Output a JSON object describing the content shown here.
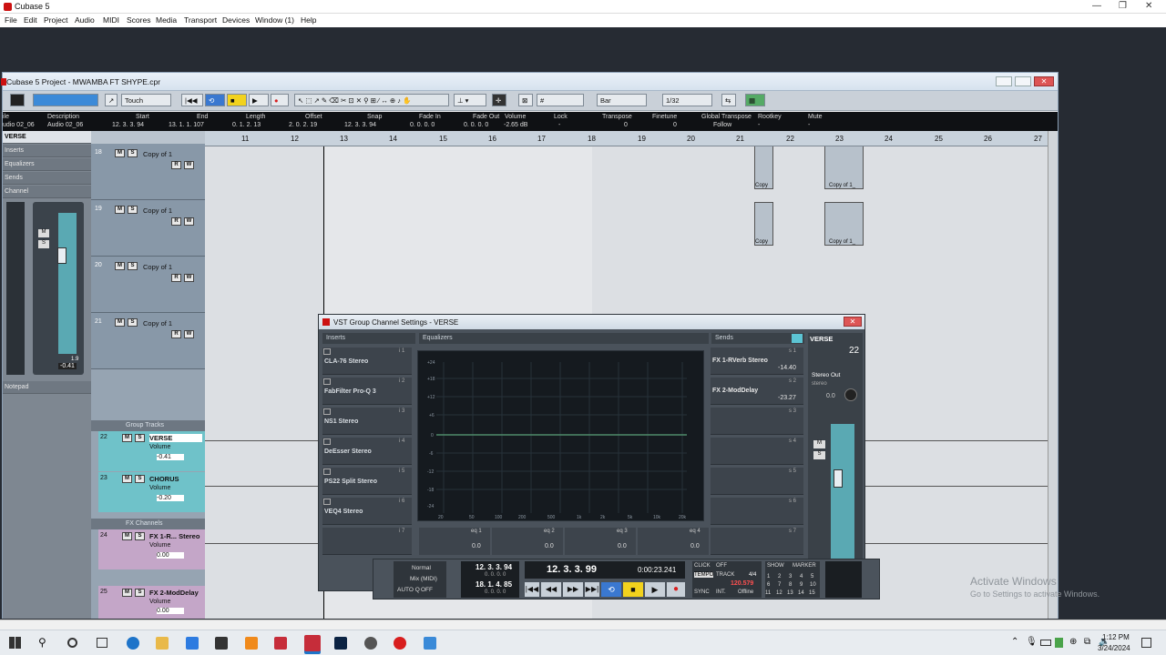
{
  "window": {
    "app_title": "Cubase 5",
    "min": "—",
    "max": "❐",
    "close": "✕"
  },
  "menu": [
    "File",
    "Edit",
    "Project",
    "Audio",
    "MIDI",
    "Scores",
    "Media",
    "Transport",
    "Devices",
    "Window (1)",
    "Help"
  ],
  "project": {
    "title": "Cubase 5 Project - MWAMBA FT SHYPE.cpr",
    "toolbar": {
      "automation_mode": "Touch",
      "grid_type": "Bar",
      "quantize": "1/32"
    },
    "infoline": {
      "headers": [
        "ile",
        "Description",
        "Start",
        "End",
        "Length",
        "Offset",
        "Snap",
        "Fade In",
        "Fade Out",
        "Volume",
        "Lock",
        "Transpose",
        "Finetune",
        "Global Transpose",
        "Rootkey",
        "Mute"
      ],
      "values": [
        "udio 02_06",
        "Audio 02_06",
        "12. 3. 3. 94",
        "13. 1. 1. 107",
        "0. 1. 2. 13",
        "2. 0. 2. 19",
        "12. 3. 3. 94",
        "0. 0. 0. 0",
        "0. 0. 0. 0",
        "-2.65 dB",
        "-",
        "0",
        "0",
        "Follow",
        "-",
        "-"
      ]
    },
    "inspector": {
      "track_name": "VERSE",
      "sections": [
        "Inserts",
        "Equalizers",
        "Sends",
        "Channel"
      ],
      "notepad": "Notepad",
      "fader_value": "-0.41",
      "meter_peak": "1.9"
    },
    "ruler": [
      "11",
      "12",
      "13",
      "14",
      "15",
      "16",
      "17",
      "18",
      "19",
      "20",
      "21",
      "22",
      "23",
      "24",
      "25",
      "26",
      "27"
    ],
    "tracks": [
      {
        "num": "18",
        "name": "Copy of 1"
      },
      {
        "num": "19",
        "name": "Copy of 1"
      },
      {
        "num": "20",
        "name": "Copy of 1"
      },
      {
        "num": "21",
        "name": "Copy of 1"
      }
    ],
    "folder_label": "Group Tracks",
    "group_tracks": [
      {
        "num": "22",
        "name": "VERSE",
        "param": "Volume",
        "value": "-0.41"
      },
      {
        "num": "23",
        "name": "CHORUS",
        "param": "Volume",
        "value": "-0.20"
      }
    ],
    "fx_folder_label": "FX Channels",
    "fx_tracks": [
      {
        "num": "24",
        "name": "FX 1-R... Stereo",
        "param": "Volume",
        "value": "0.00"
      },
      {
        "num": "25",
        "name": "FX 2-ModDelay",
        "param": "Volume",
        "value": "0.00"
      }
    ],
    "events": [
      "Copy",
      "Copy of 1_",
      "Copy",
      "Copy of 1_"
    ]
  },
  "vst": {
    "title": "VST Group Channel Settings - VERSE",
    "inserts_label": "Inserts",
    "eq_label": "Equalizers",
    "sends_label": "Sends",
    "channel_name": "VERSE",
    "channel_number": "22",
    "output": "Stereo Out",
    "output_sub": "stereo",
    "pan_value": "0.0",
    "inserts": [
      {
        "slot": "i 1",
        "name": "CLA-76 Stereo"
      },
      {
        "slot": "i 2",
        "name": "FabFilter Pro-Q 3"
      },
      {
        "slot": "i 3",
        "name": "NS1 Stereo"
      },
      {
        "slot": "i 4",
        "name": "DeEsser Stereo"
      },
      {
        "slot": "i 5",
        "name": "PS22 Split Stereo"
      },
      {
        "slot": "i 6",
        "name": "VEQ4 Stereo"
      },
      {
        "slot": "i 7",
        "name": ""
      }
    ],
    "eq_db_labels": [
      "+24",
      "+18",
      "+12",
      "+6",
      "0",
      "-6",
      "-12",
      "-18",
      "-24"
    ],
    "eq_freq_labels": [
      "20",
      "50",
      "100",
      "200",
      "500",
      "1k",
      "2k",
      "5k",
      "10k",
      "20k"
    ],
    "eq_bands": [
      {
        "label": "eq 1",
        "value": "0.0"
      },
      {
        "label": "eq 2",
        "value": "0.0"
      },
      {
        "label": "eq 3",
        "value": "0.0"
      },
      {
        "label": "eq 4",
        "value": "0.0"
      }
    ],
    "sends": [
      {
        "slot": "s 1",
        "name": "FX 1-RVerb Stereo",
        "value": "-14.40"
      },
      {
        "slot": "s 2",
        "name": "FX 2-ModDelay",
        "value": "-23.27"
      },
      {
        "slot": "s 3",
        "name": "",
        "value": ""
      },
      {
        "slot": "s 4",
        "name": "",
        "value": ""
      },
      {
        "slot": "s 5",
        "name": "",
        "value": ""
      },
      {
        "slot": "s 6",
        "name": "",
        "value": ""
      },
      {
        "slot": "s 7",
        "name": "",
        "value": ""
      }
    ]
  },
  "transport": {
    "mode": "Normal",
    "mix": "Mix (MIDI)",
    "auto_q": "AUTO Q",
    "off": "OFF",
    "left_locator": "12. 3. 3. 94",
    "left_sub": "0. 0. 0. 0",
    "right_locator": "18. 1. 4. 85",
    "right_sub": "0. 0. 0. 0",
    "position_bars": "12. 3. 3. 99",
    "position_time": "0:00:23.241",
    "click": "CLICK",
    "click_state": "OFF",
    "tempo": "TEMPO",
    "track": "TRACK",
    "signature": "4/4",
    "tempo_value": "120.579",
    "sync": "SYNC",
    "int": "INT.",
    "offline": "Offline",
    "show": "SHOW",
    "marker": "MARKER",
    "marker_nums": [
      "1",
      "2",
      "3",
      "4",
      "5",
      "6",
      "7",
      "8",
      "9",
      "10",
      "11",
      "12",
      "13",
      "14",
      "15"
    ]
  },
  "watermark": {
    "line1": "Activate Windows",
    "line2": "Go to Settings to activate Windows."
  },
  "taskbar": {
    "time": "1:12 PM",
    "date": "3/24/2024"
  },
  "colors": {
    "accent": "#2f7fd6",
    "record": "#d81e1e",
    "cycle": "#3a78d0",
    "stop": "#f2d21d"
  }
}
